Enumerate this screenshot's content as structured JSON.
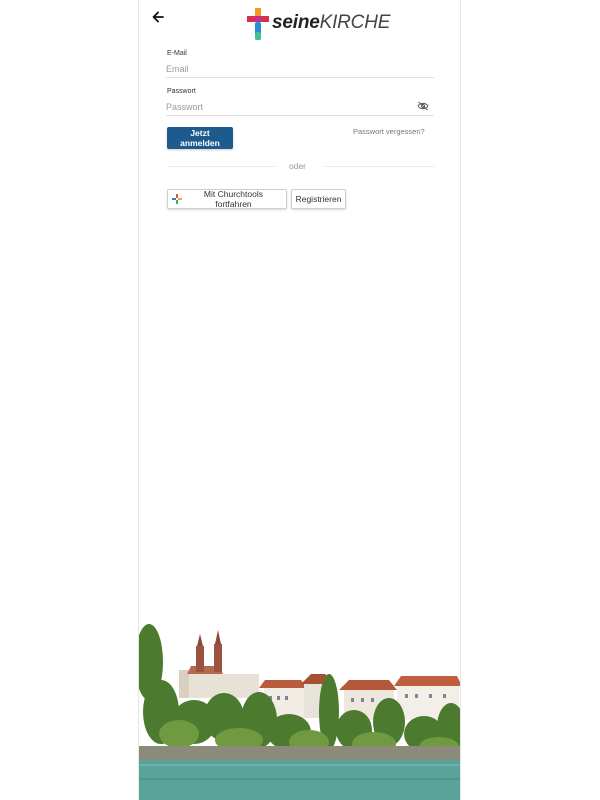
{
  "header": {
    "back_icon": "arrow-left-icon",
    "logo": {
      "part1": "seine",
      "part2": "KIRCHE"
    }
  },
  "form": {
    "email": {
      "label": "E-Mail",
      "placeholder": "Email",
      "value": ""
    },
    "password": {
      "label": "Passwort",
      "placeholder": "Passwort",
      "value": "",
      "toggle_icon": "eye-off-icon"
    },
    "submit_label": "Jetzt anmelden",
    "forgot_label": "Passwort vergessen?",
    "divider_text": "oder",
    "churchtools_label": "Mit Churchtools fortfahren",
    "churchtools_icon": "churchtools-icon",
    "register_label": "Registrieren"
  },
  "colors": {
    "primary": "#1d5a8e",
    "logo_cross_orange": "#f29a1f",
    "logo_cross_red": "#d6304a",
    "logo_cross_blue": "#2a8fd0",
    "river": "#5aa39a"
  }
}
